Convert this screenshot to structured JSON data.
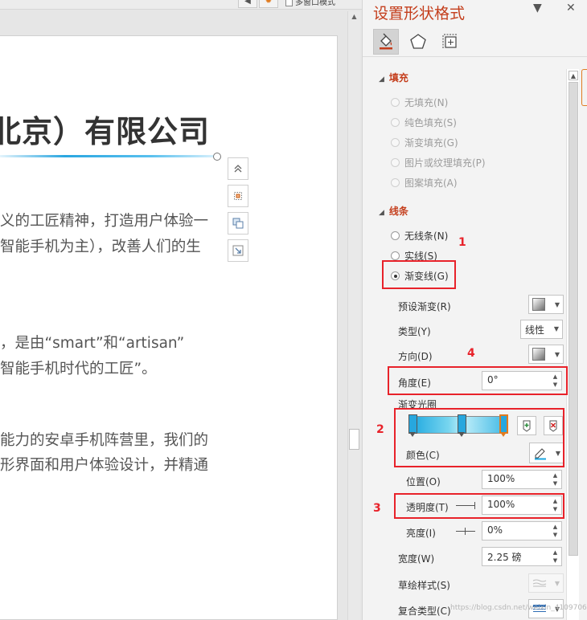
{
  "editor": {
    "toolbar": {
      "checkbox_label": "多窗口模式"
    },
    "title": "北京）有限公司",
    "paragraphs": [
      "义的工匠精神，打造用户体验一",
      "智能手机为主），改善人们的生",
      "，是由“smart”和“artisan”",
      "智能手机时代的工匠”。",
      "能力的安卓手机阵营里，我们的",
      "形界面和用户体验设计，并精通"
    ],
    "tools": [
      "collapse-up-icon",
      "align-center-icon",
      "layer-icon",
      "resize-icon"
    ]
  },
  "pane": {
    "title": "设置形状格式",
    "dropdown_glyph": "▼",
    "close_glyph": "✕",
    "tabs": [
      "fill-line-icon",
      "effects-pentagon-icon",
      "size-properties-icon"
    ],
    "fill": {
      "header": "填充",
      "options": [
        "无填充(N)",
        "纯色填充(S)",
        "渐变填充(G)",
        "图片或纹理填充(P)",
        "图案填充(A)"
      ]
    },
    "line": {
      "header": "线条",
      "options": [
        "无线条(N)",
        "实线(S)",
        "渐变线(G)"
      ],
      "selected": "渐变线(G)",
      "preset_label": "预设渐变(R)",
      "type_label": "类型(Y)",
      "type_value": "线性",
      "direction_label": "方向(D)",
      "angle_label": "角度(E)",
      "angle_value": "0°",
      "stops_label": "渐变光圈",
      "color_label": "颜色(C)",
      "position_label": "位置(O)",
      "position_value": "100%",
      "transparency_label": "透明度(T)",
      "transparency_value": "100%",
      "brightness_label": "亮度(I)",
      "brightness_value": "0%",
      "width_label": "宽度(W)",
      "width_value": "2.25 磅",
      "sketch_label": "草绘样式(S)",
      "compound_label": "复合类型(C)"
    }
  },
  "annotations": {
    "marker1": "1",
    "marker2": "2",
    "marker3": "3",
    "marker4": "4",
    "color": "#e8222a"
  },
  "watermark": "https://blog.csdn.net/weixin_41097067",
  "colors": {
    "accent": "#c43e1c",
    "gradient_blue": "#1ba6df",
    "selected_stop": "#e07b20"
  }
}
